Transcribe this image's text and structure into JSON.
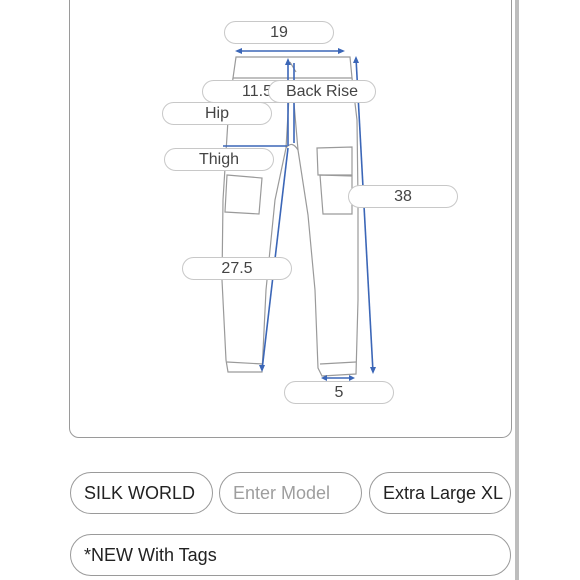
{
  "measurements": {
    "waist": "19",
    "front_rise": "11.5",
    "back_rise": "Back Rise",
    "hip": "Hip",
    "thigh": "Thigh",
    "outseam": "38",
    "inseam": "27.5",
    "leg_opening": "5"
  },
  "form": {
    "brand": "SILK WORLD",
    "model_placeholder": "Enter Model",
    "size": "Extra Large XL",
    "condition": "*NEW With Tags"
  },
  "colors": {
    "measure_line": "#3b66b7",
    "outline": "#8a8a8a"
  }
}
